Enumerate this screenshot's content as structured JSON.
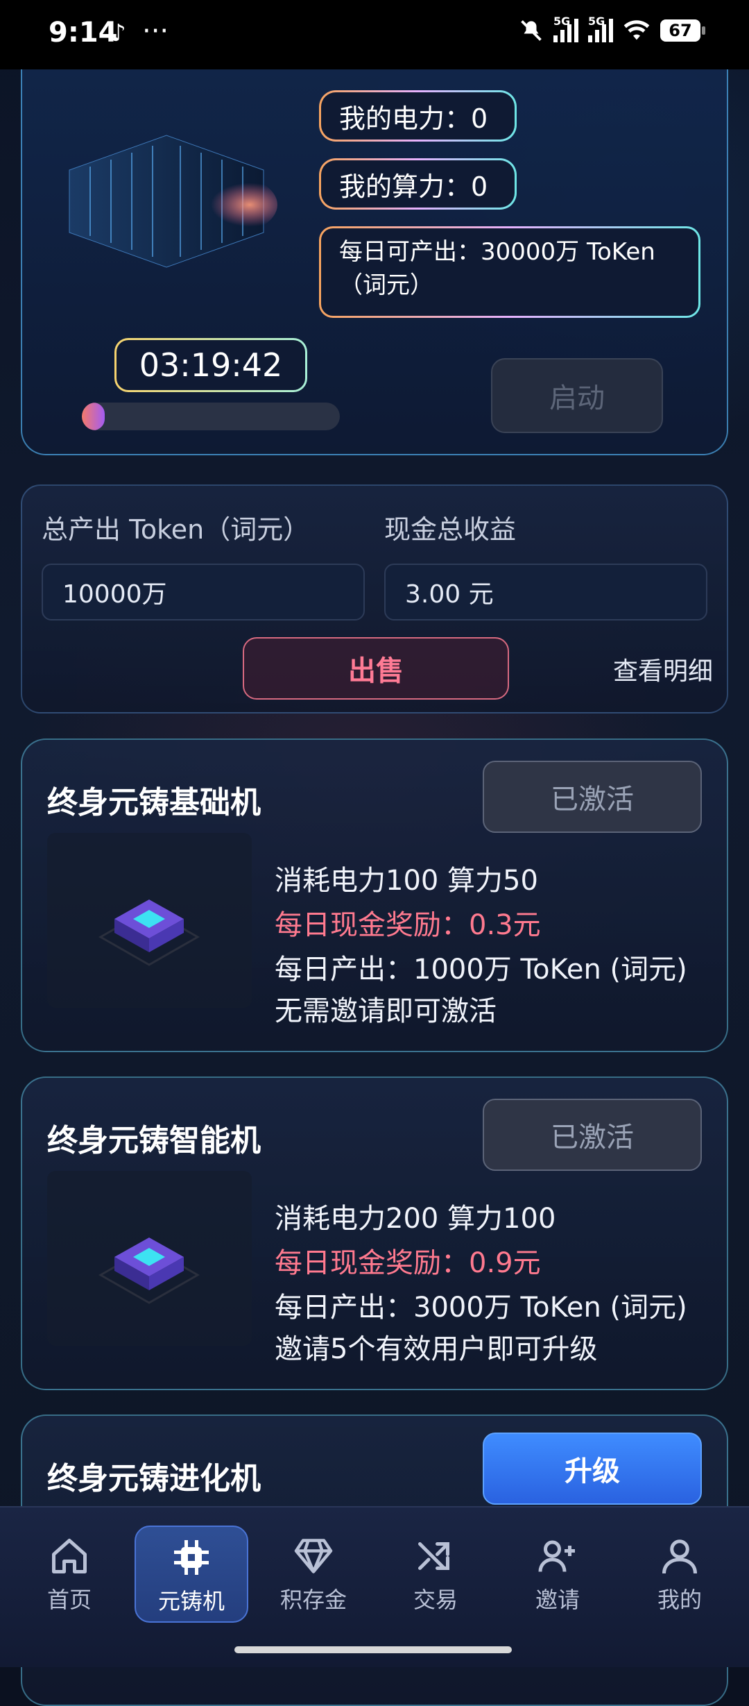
{
  "status_bar": {
    "time": "9:14",
    "tiktok": "♪",
    "more": "···",
    "net1": "5G",
    "net2": "5G",
    "battery": "67"
  },
  "miner": {
    "my_power": "我的电力：0",
    "my_compute": "我的算力：0",
    "daily_output": "每日可产出：30000万 ToKen（词元）",
    "timer": "03:19:42",
    "progress": 0.09,
    "start_label": "启动"
  },
  "summary": {
    "total_token_label": "总产出 Token（词元）",
    "total_token_value": "10000万",
    "cash_label": "现金总收益",
    "cash_value": "3.00 元",
    "sell_label": "出售",
    "detail_label": "查看明细"
  },
  "machines": [
    {
      "title": "终身元铸基础机",
      "button": "已激活",
      "consume": "消耗电力100 算力50",
      "reward": "每日现金奖励：0.3元",
      "output": "每日产出：1000万 ToKen (词元)",
      "condition": "无需邀请即可激活"
    },
    {
      "title": "终身元铸智能机",
      "button": "已激活",
      "consume": "消耗电力200 算力100",
      "reward": "每日现金奖励：0.9元",
      "output": "每日产出：3000万 ToKen (词元)",
      "condition": "邀请5个有效用户即可升级"
    },
    {
      "title": "终身元铸进化机",
      "button": "升级"
    }
  ],
  "nav": [
    {
      "label": "首页",
      "icon": "home-icon"
    },
    {
      "label": "元铸机",
      "icon": "chip-icon"
    },
    {
      "label": "积存金",
      "icon": "diamond-icon"
    },
    {
      "label": "交易",
      "icon": "shuffle-icon"
    },
    {
      "label": "邀请",
      "icon": "add-user-icon"
    },
    {
      "label": "我的",
      "icon": "user-icon"
    }
  ],
  "colors": {
    "accent": "#3f8cff",
    "reward": "#ff7a8f",
    "sell": "#ff7b95"
  }
}
